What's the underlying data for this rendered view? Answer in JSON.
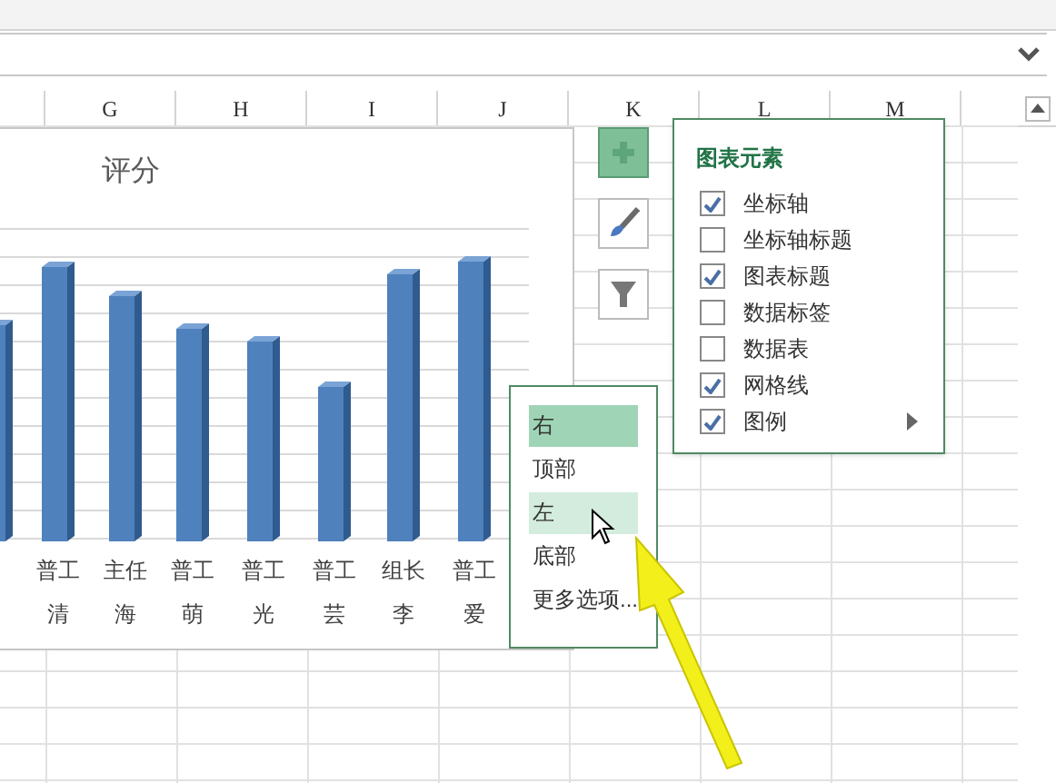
{
  "columns": [
    "G",
    "H",
    "I",
    "J",
    "K",
    "L",
    "M"
  ],
  "chart": {
    "title": "评分",
    "categories": [
      {
        "line1": "普工",
        "line2": "清"
      },
      {
        "line1": "主任",
        "line2": "海"
      },
      {
        "line1": "普工",
        "line2": "萌"
      },
      {
        "line1": "普工",
        "line2": "光"
      },
      {
        "line1": "普工",
        "line2": "芸"
      },
      {
        "line1": "组长",
        "line2": "李"
      },
      {
        "line1": "普工",
        "line2": "爱"
      }
    ]
  },
  "chart_elements": {
    "title": "图表元素",
    "items": [
      {
        "label": "坐标轴",
        "checked": true
      },
      {
        "label": "坐标轴标题",
        "checked": false
      },
      {
        "label": "图表标题",
        "checked": true
      },
      {
        "label": "数据标签",
        "checked": false
      },
      {
        "label": "数据表",
        "checked": false
      },
      {
        "label": "网格线",
        "checked": true
      },
      {
        "label": "图例",
        "checked": true,
        "submenu": true
      }
    ]
  },
  "legend_menu": [
    {
      "label": "右",
      "selected": true,
      "hovered": false
    },
    {
      "label": "顶部",
      "selected": false,
      "hovered": false
    },
    {
      "label": "左",
      "selected": false,
      "hovered": true
    },
    {
      "label": "底部",
      "selected": false,
      "hovered": false
    },
    {
      "label": "更多选项...",
      "selected": false,
      "hovered": false
    }
  ]
}
